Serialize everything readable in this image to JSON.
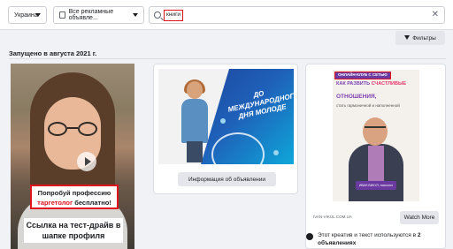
{
  "header": {
    "country": "Украина",
    "ad_type": "Все рекламные объявле...",
    "search_value": "книги",
    "filters_label": "Фильтры"
  },
  "section": {
    "launched_label": "Запущено в августа 2021 г."
  },
  "card_video": {
    "caption_prefix": "Попробуй профессию",
    "caption_highlight": "таргетолог",
    "caption_suffix": " бесплатно!",
    "caption_main": "Ссылка на тест-драйв в шапке профиля"
  },
  "card_banner": {
    "banner_title": "ДО МЕЖДУНАРОДНОГО ДНЯ МОЛОДЕ",
    "info_button": "Информация об объявлении"
  },
  "card_poster": {
    "badge": "ОНЛАЙН-КЛУБ С СЕТЬЮ",
    "headline_top": "КАК РАЗВИТЬ",
    "headline_pink": "СЧАСТЛИВЫЕ",
    "headline_main": "ОТНОШЕНИЯ,",
    "headline_tail": "стать гармоничной и наполненной",
    "signature": "ИВАН ВИКУЛ, психолог",
    "domain": "IVAN-VIKUL.COM.UA",
    "watch_button": "Watch More",
    "note_prefix": "Этот креатив и текст используются в ",
    "note_bold": "2 объявлениях"
  },
  "colors": {
    "accent_red": "#e0141e",
    "poster_purple": "#7b3fb0",
    "poster_pink": "#e4346c"
  }
}
